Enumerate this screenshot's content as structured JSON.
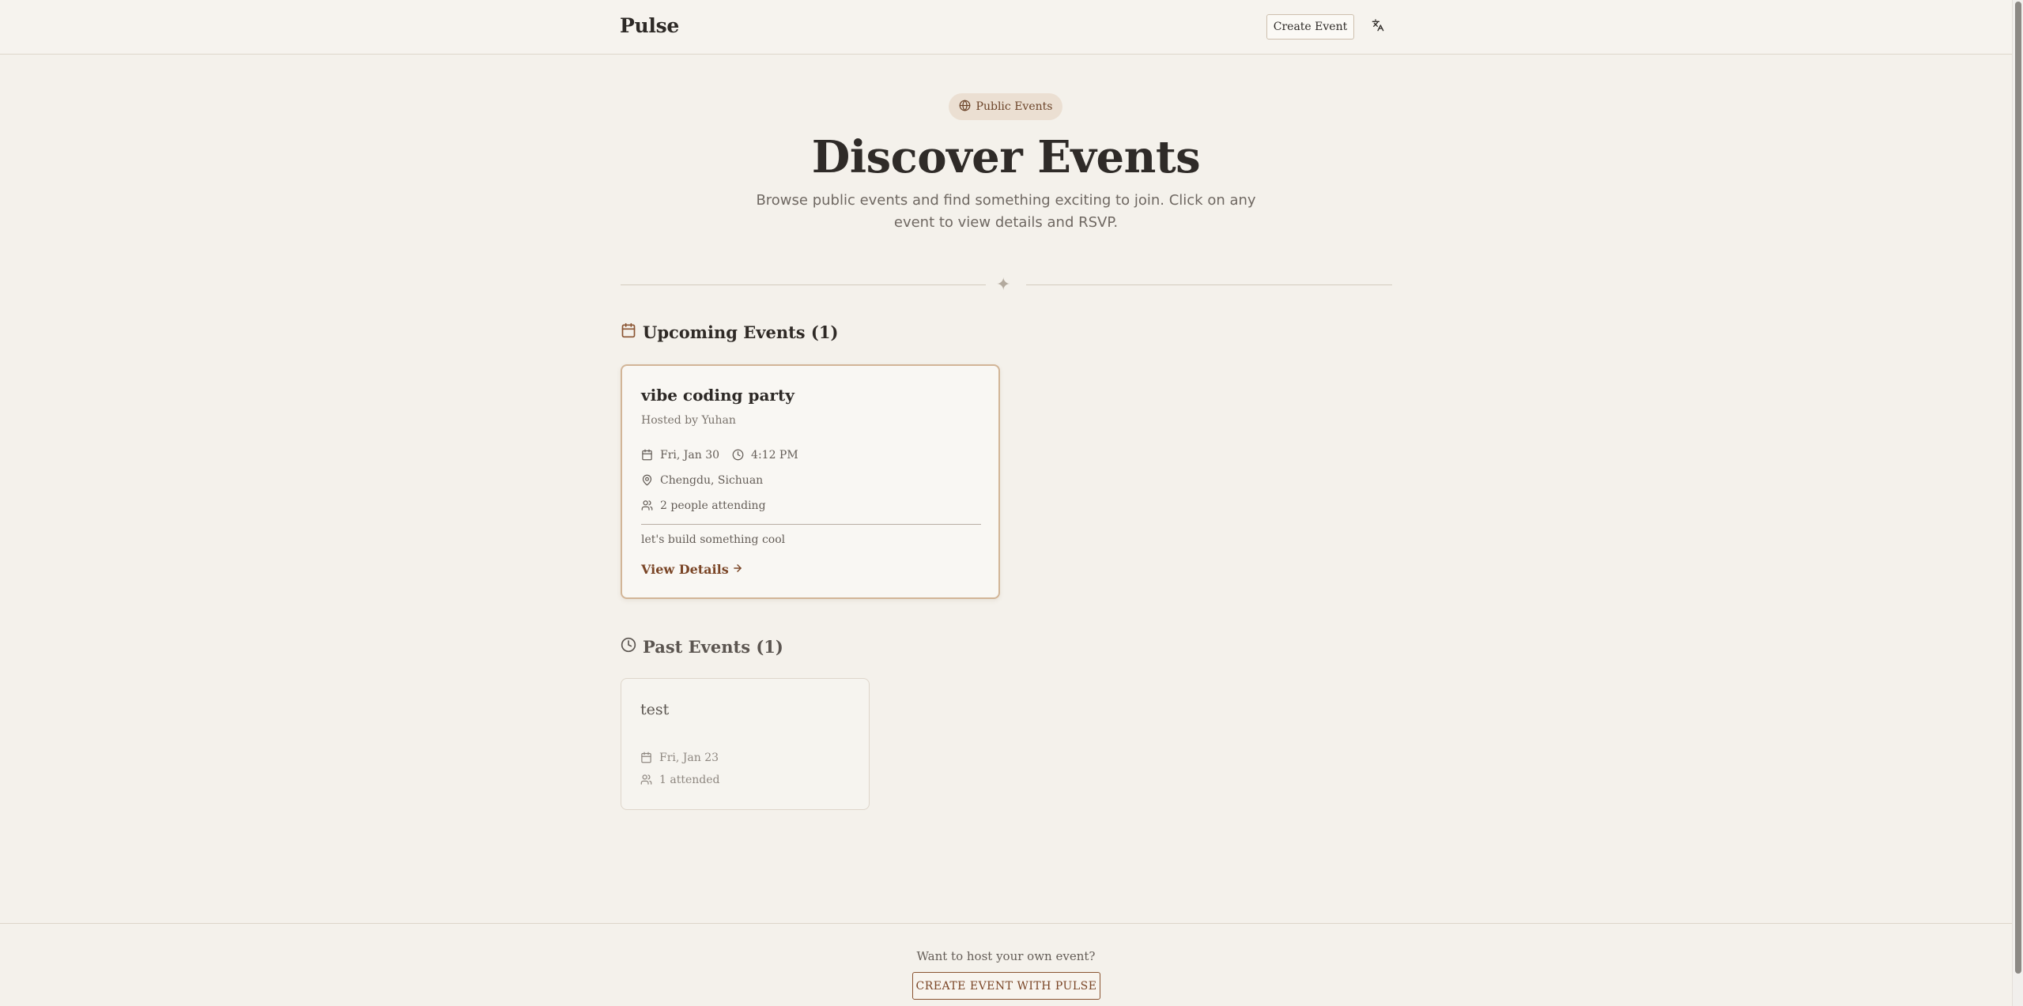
{
  "header": {
    "brand": "Pulse",
    "create_event_label": "Create Event"
  },
  "hero": {
    "badge_label": "Public Events",
    "title": "Discover Events",
    "subtitle": "Browse public events and find something exciting to join. Click on any event to view details and RSVP."
  },
  "upcoming": {
    "heading": "Upcoming Events (1)",
    "events": [
      {
        "name": "vibe coding party",
        "host": "Hosted by Yuhan",
        "date": "Fri, Jan 30",
        "time": "4:12 PM",
        "location": "Chengdu, Sichuan",
        "attendance": "2 people attending",
        "description": "let's build something cool",
        "details_label": "View Details"
      }
    ]
  },
  "past": {
    "heading": "Past Events (1)",
    "events": [
      {
        "name": "test",
        "date": "Fri, Jan 23",
        "attendance": "1 attended"
      }
    ]
  },
  "footer": {
    "prompt": "Want to host your own event?",
    "cta_label": "CREATE EVENT WITH PULSE"
  },
  "colors": {
    "background": "#f4f1eb",
    "accent": "#7a4526",
    "card_border_highlight": "#d2b597"
  }
}
